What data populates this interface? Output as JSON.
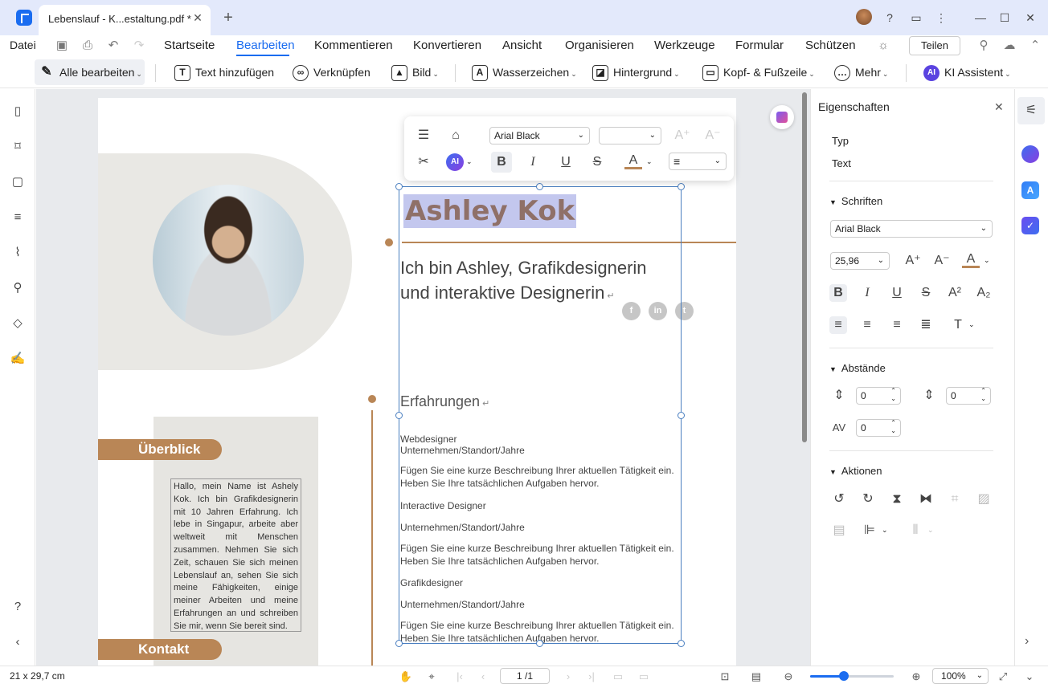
{
  "window": {
    "tab_title": "Lebenslauf - K...estaltung.pdf *",
    "close": "✕",
    "new_tab": "+"
  },
  "menubar": {
    "datei": "Datei",
    "items": [
      "Startseite",
      "Bearbeiten",
      "Kommentieren",
      "Konvertieren",
      "Ansicht",
      "Organisieren",
      "Werkzeuge",
      "Formular",
      "Schützen"
    ],
    "active": "Bearbeiten",
    "share": "Teilen"
  },
  "toolbar": {
    "alle": "Alle bearbeiten",
    "text": "Text hinzufügen",
    "link": "Verknüpfen",
    "bild": "Bild",
    "wasser": "Wasserzeichen",
    "hinter": "Hintergrund",
    "kopf": "Kopf- & Fußzeile",
    "mehr": "Mehr",
    "ki": "KI Assistent",
    "ki_badge": "AI"
  },
  "document": {
    "name": "Ashley Kok",
    "tagline": "Ich bin Ashley, Grafikdesignerin und interaktive Designerin",
    "ueberblick": "Überblick",
    "kontakt": "Kontakt",
    "intro": "Hallo, mein Name ist Ashely Kok. Ich bin Grafikdesignerin mit 10 Jahren Erfahrung. Ich lebe in Singapur, arbeite aber weltweit mit Menschen zusammen. Nehmen Sie sich Zeit, schauen Sie sich meinen Lebenslauf an, sehen Sie sich meine Fähigkeiten, einige meiner Arbeiten und meine Erfahrungen an und schreiben Sie mir, wenn Sie bereit sind.",
    "erfahrungen": "Erfahrungen",
    "jobs": [
      {
        "title": "Webdesigner",
        "company": "Unternehmen/Standort/Jahre",
        "desc1": "Fügen Sie eine kurze Beschreibung Ihrer aktuellen Tätigkeit ein.",
        "desc2": "Heben Sie Ihre tatsächlichen Aufgaben hervor."
      },
      {
        "title": "Interactive Designer",
        "company": "Unternehmen/Standort/Jahre",
        "desc1": "Fügen Sie eine kurze Beschreibung Ihrer aktuellen Tätigkeit ein.",
        "desc2": "Heben Sie Ihre tatsächlichen Aufgaben hervor."
      },
      {
        "title": "Grafikdesigner",
        "company": "Unternehmen/Standort/Jahre",
        "desc1": "Fügen Sie eine kurze Beschreibung Ihrer aktuellen Tätigkeit ein.",
        "desc2": "Heben Sie Ihre tatsächlichen Aufgaben hervor."
      }
    ],
    "social": [
      "f",
      "in",
      "t"
    ],
    "para_mark": "↵"
  },
  "float_toolbar": {
    "font": "Arial Black",
    "size": "",
    "ai": "AI"
  },
  "properties": {
    "title": "Eigenschaften",
    "typ_label": "Typ",
    "typ_value": "Text",
    "schriften": "Schriften",
    "font": "Arial Black",
    "size": "25,96",
    "abstaende": "Abstände",
    "line_spacing": "0",
    "para_spacing": "0",
    "char_spacing": "0",
    "aktionen": "Aktionen"
  },
  "status": {
    "page_size": "21 x 29,7 cm",
    "page": "1 /1",
    "zoom": "100%",
    "zoom_level": 0.4
  },
  "colors": {
    "accent": "#1a6cf0",
    "brand_brown": "#b98656",
    "selection": "#c3c7ee"
  }
}
